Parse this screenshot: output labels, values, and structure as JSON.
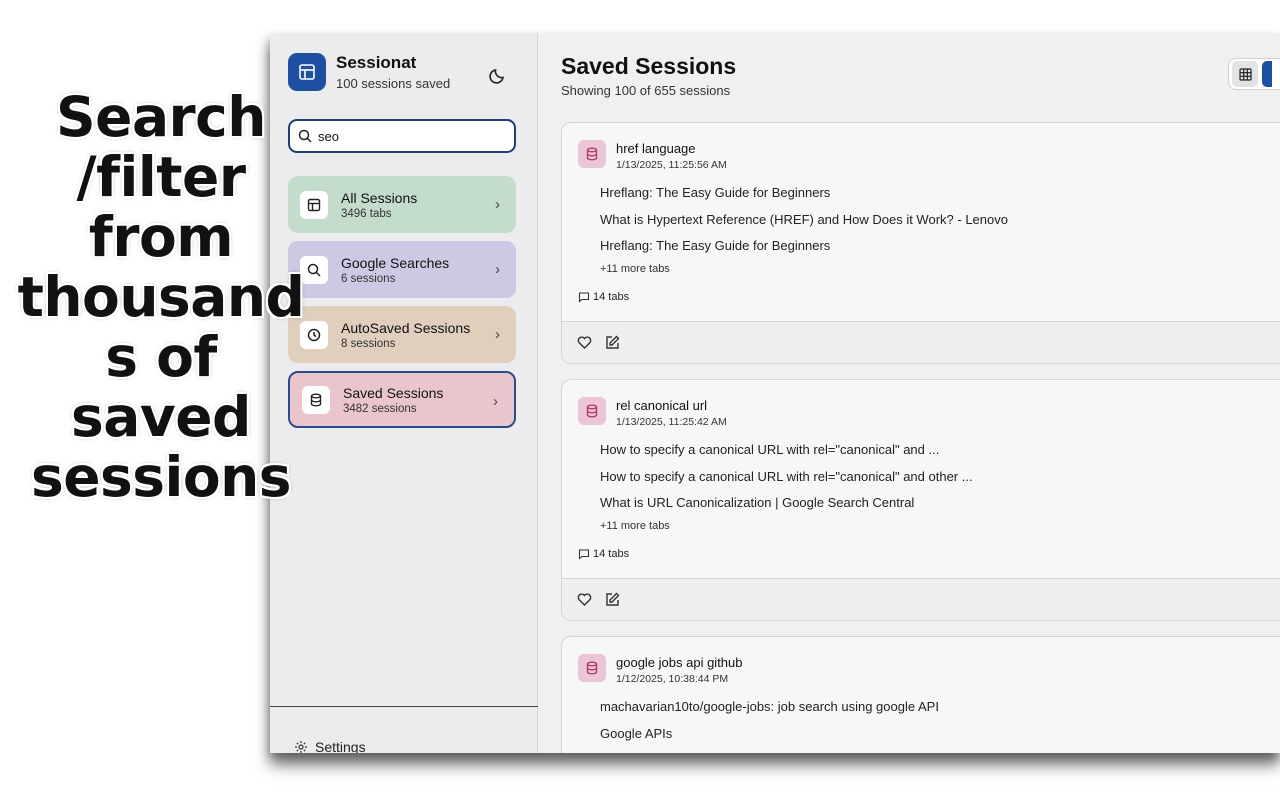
{
  "promo": {
    "lines": [
      "Search",
      "/filter",
      "from",
      "thousand",
      "s of",
      "saved",
      "sessions"
    ]
  },
  "app": {
    "name": "Sessionat",
    "sessions_saved": "100 sessions saved"
  },
  "search": {
    "value": "seo"
  },
  "sidebar": {
    "items": [
      {
        "label": "All Sessions",
        "count": "3496 tabs",
        "icon": "layout-icon"
      },
      {
        "label": "Google Searches",
        "count": "6 sessions",
        "icon": "search-icon"
      },
      {
        "label": "AutoSaved Sessions",
        "count": "8 sessions",
        "icon": "clock-icon"
      },
      {
        "label": "Saved Sessions",
        "count": "3482 sessions",
        "icon": "database-icon"
      }
    ],
    "settings_label": "Settings"
  },
  "main": {
    "title": "Saved Sessions",
    "subtitle": "Showing 100 of 655 sessions"
  },
  "sessions": [
    {
      "title": "href language",
      "date": "1/13/2025, 11:25:56 AM",
      "tabs": [
        "Hreflang: The Easy Guide for Beginners",
        "What is Hypertext Reference (HREF) and How Does it Work? - Lenovo",
        "Hreflang: The Easy Guide for Beginners"
      ],
      "more": "+11 more tabs",
      "tab_count": "14 tabs"
    },
    {
      "title": "rel canonical url",
      "date": "1/13/2025, 11:25:42 AM",
      "tabs": [
        "How to specify a canonical URL with rel=\"canonical\" and ...",
        "How to specify a canonical URL with rel=\"canonical\" and other ...",
        "What is URL Canonicalization | Google Search Central"
      ],
      "more": "+11 more tabs",
      "tab_count": "14 tabs"
    },
    {
      "title": "google jobs api github",
      "date": "1/12/2025, 10:38:44 PM",
      "tabs": [
        "machavarian10to/google-jobs: job search using google API",
        "Google APIs"
      ]
    }
  ],
  "colors": {
    "accent": "#1e4fa3",
    "all_sessions_bg": "#c4dccb",
    "google_searches_bg": "#cbc9e3",
    "autosaved_bg": "#e1cfbd",
    "saved_bg": "#e9c6cd",
    "session_icon_bg": "#ecc6d6"
  }
}
